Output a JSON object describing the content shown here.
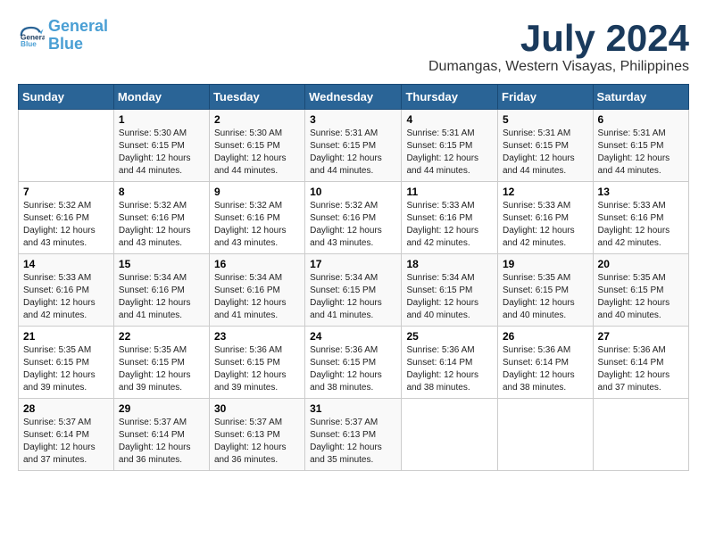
{
  "header": {
    "logo_line1": "General",
    "logo_line2": "Blue",
    "month": "July 2024",
    "location": "Dumangas, Western Visayas, Philippines"
  },
  "weekdays": [
    "Sunday",
    "Monday",
    "Tuesday",
    "Wednesday",
    "Thursday",
    "Friday",
    "Saturday"
  ],
  "weeks": [
    [
      {
        "day": "",
        "info": ""
      },
      {
        "day": "1",
        "info": "Sunrise: 5:30 AM\nSunset: 6:15 PM\nDaylight: 12 hours\nand 44 minutes."
      },
      {
        "day": "2",
        "info": "Sunrise: 5:30 AM\nSunset: 6:15 PM\nDaylight: 12 hours\nand 44 minutes."
      },
      {
        "day": "3",
        "info": "Sunrise: 5:31 AM\nSunset: 6:15 PM\nDaylight: 12 hours\nand 44 minutes."
      },
      {
        "day": "4",
        "info": "Sunrise: 5:31 AM\nSunset: 6:15 PM\nDaylight: 12 hours\nand 44 minutes."
      },
      {
        "day": "5",
        "info": "Sunrise: 5:31 AM\nSunset: 6:15 PM\nDaylight: 12 hours\nand 44 minutes."
      },
      {
        "day": "6",
        "info": "Sunrise: 5:31 AM\nSunset: 6:15 PM\nDaylight: 12 hours\nand 44 minutes."
      }
    ],
    [
      {
        "day": "7",
        "info": "Sunrise: 5:32 AM\nSunset: 6:16 PM\nDaylight: 12 hours\nand 43 minutes."
      },
      {
        "day": "8",
        "info": "Sunrise: 5:32 AM\nSunset: 6:16 PM\nDaylight: 12 hours\nand 43 minutes."
      },
      {
        "day": "9",
        "info": "Sunrise: 5:32 AM\nSunset: 6:16 PM\nDaylight: 12 hours\nand 43 minutes."
      },
      {
        "day": "10",
        "info": "Sunrise: 5:32 AM\nSunset: 6:16 PM\nDaylight: 12 hours\nand 43 minutes."
      },
      {
        "day": "11",
        "info": "Sunrise: 5:33 AM\nSunset: 6:16 PM\nDaylight: 12 hours\nand 42 minutes."
      },
      {
        "day": "12",
        "info": "Sunrise: 5:33 AM\nSunset: 6:16 PM\nDaylight: 12 hours\nand 42 minutes."
      },
      {
        "day": "13",
        "info": "Sunrise: 5:33 AM\nSunset: 6:16 PM\nDaylight: 12 hours\nand 42 minutes."
      }
    ],
    [
      {
        "day": "14",
        "info": "Sunrise: 5:33 AM\nSunset: 6:16 PM\nDaylight: 12 hours\nand 42 minutes."
      },
      {
        "day": "15",
        "info": "Sunrise: 5:34 AM\nSunset: 6:16 PM\nDaylight: 12 hours\nand 41 minutes."
      },
      {
        "day": "16",
        "info": "Sunrise: 5:34 AM\nSunset: 6:16 PM\nDaylight: 12 hours\nand 41 minutes."
      },
      {
        "day": "17",
        "info": "Sunrise: 5:34 AM\nSunset: 6:15 PM\nDaylight: 12 hours\nand 41 minutes."
      },
      {
        "day": "18",
        "info": "Sunrise: 5:34 AM\nSunset: 6:15 PM\nDaylight: 12 hours\nand 40 minutes."
      },
      {
        "day": "19",
        "info": "Sunrise: 5:35 AM\nSunset: 6:15 PM\nDaylight: 12 hours\nand 40 minutes."
      },
      {
        "day": "20",
        "info": "Sunrise: 5:35 AM\nSunset: 6:15 PM\nDaylight: 12 hours\nand 40 minutes."
      }
    ],
    [
      {
        "day": "21",
        "info": "Sunrise: 5:35 AM\nSunset: 6:15 PM\nDaylight: 12 hours\nand 39 minutes."
      },
      {
        "day": "22",
        "info": "Sunrise: 5:35 AM\nSunset: 6:15 PM\nDaylight: 12 hours\nand 39 minutes."
      },
      {
        "day": "23",
        "info": "Sunrise: 5:36 AM\nSunset: 6:15 PM\nDaylight: 12 hours\nand 39 minutes."
      },
      {
        "day": "24",
        "info": "Sunrise: 5:36 AM\nSunset: 6:15 PM\nDaylight: 12 hours\nand 38 minutes."
      },
      {
        "day": "25",
        "info": "Sunrise: 5:36 AM\nSunset: 6:14 PM\nDaylight: 12 hours\nand 38 minutes."
      },
      {
        "day": "26",
        "info": "Sunrise: 5:36 AM\nSunset: 6:14 PM\nDaylight: 12 hours\nand 38 minutes."
      },
      {
        "day": "27",
        "info": "Sunrise: 5:36 AM\nSunset: 6:14 PM\nDaylight: 12 hours\nand 37 minutes."
      }
    ],
    [
      {
        "day": "28",
        "info": "Sunrise: 5:37 AM\nSunset: 6:14 PM\nDaylight: 12 hours\nand 37 minutes."
      },
      {
        "day": "29",
        "info": "Sunrise: 5:37 AM\nSunset: 6:14 PM\nDaylight: 12 hours\nand 36 minutes."
      },
      {
        "day": "30",
        "info": "Sunrise: 5:37 AM\nSunset: 6:13 PM\nDaylight: 12 hours\nand 36 minutes."
      },
      {
        "day": "31",
        "info": "Sunrise: 5:37 AM\nSunset: 6:13 PM\nDaylight: 12 hours\nand 35 minutes."
      },
      {
        "day": "",
        "info": ""
      },
      {
        "day": "",
        "info": ""
      },
      {
        "day": "",
        "info": ""
      }
    ]
  ]
}
